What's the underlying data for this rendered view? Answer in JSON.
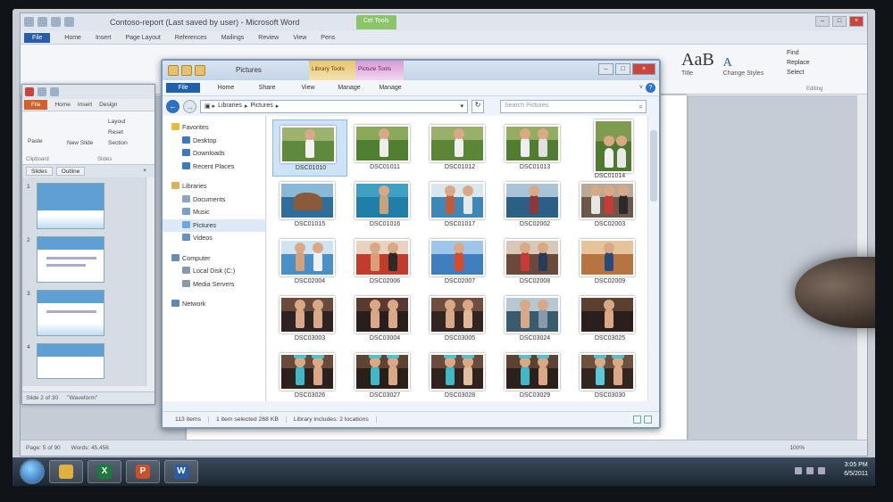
{
  "word": {
    "title": "Contoso-report (Last saved by user) - Microsoft Word",
    "context_tab": "Cel Tools",
    "tabs": [
      "File",
      "Home",
      "Insert",
      "Page Layout",
      "References",
      "Mailings",
      "Review",
      "View",
      "Pens"
    ],
    "style_sample": "AaB",
    "style_labels": [
      "Title",
      "Change Styles"
    ],
    "editing": [
      "Find",
      "Replace",
      "Select"
    ],
    "editing_group": "Editing",
    "status": {
      "page": "Page: 5 of 90",
      "words": "Words: 45,456",
      "zoom": "100%"
    }
  },
  "ppt": {
    "tabs": [
      "File",
      "Home",
      "Insert",
      "Design"
    ],
    "ribbon": {
      "paste": "Paste",
      "new_slide": "New Slide",
      "layout": "Layout",
      "reset": "Reset",
      "section": "Section",
      "clipboard": "Clipboard",
      "slides": "Slides"
    },
    "pane_tabs": [
      "Slides",
      "Outline"
    ],
    "slide_numbers": [
      "1",
      "2",
      "3",
      "4"
    ],
    "status": {
      "slide": "Slide 2 of 30",
      "theme": "\"Waveform\""
    }
  },
  "explorer": {
    "title": "Pictures",
    "context_tabs": [
      "Library Tools",
      "Picture Tools"
    ],
    "ribbon_tabs": [
      "File",
      "Home",
      "Share",
      "View",
      "Manage",
      "Manage"
    ],
    "breadcrumb": [
      "Libraries",
      "Pictures"
    ],
    "search_placeholder": "Search Pictures",
    "nav": [
      {
        "label": "Favorites",
        "top": true,
        "color": "#e8b93a"
      },
      {
        "label": "Desktop",
        "color": "#3c78c4"
      },
      {
        "label": "Downloads",
        "color": "#3c78c4"
      },
      {
        "label": "Recent Places",
        "color": "#3c78c4"
      },
      {
        "gap": true
      },
      {
        "label": "Libraries",
        "top": true,
        "color": "#d9b25a"
      },
      {
        "label": "Documents",
        "color": "#8ea6c2"
      },
      {
        "label": "Music",
        "color": "#7a9fd1"
      },
      {
        "label": "Pictures",
        "color": "#6fa7d8",
        "selected": true
      },
      {
        "label": "Videos",
        "color": "#6c8fbf"
      },
      {
        "gap": true
      },
      {
        "label": "Computer",
        "top": true,
        "color": "#6b8bb3"
      },
      {
        "label": "Local Disk (C:)",
        "color": "#8a99aa"
      },
      {
        "label": "Media Servers",
        "color": "#8a99aa"
      },
      {
        "gap": true
      },
      {
        "label": "Network",
        "top": true,
        "color": "#5f88b8"
      }
    ],
    "files": [
      {
        "name": "DSC01010",
        "bg": "#5f8a3c",
        "sky": "#9cb36d",
        "figs": [
          "#f2f2f2"
        ],
        "selected": true
      },
      {
        "name": "DSC01011",
        "bg": "#4f7f2f",
        "sky": "#8aa95a",
        "figs": [
          "#ececec"
        ]
      },
      {
        "name": "DSC01012",
        "bg": "#5a8635",
        "sky": "#98b06a",
        "figs": [
          "#f0f0f0"
        ]
      },
      {
        "name": "DSC01013",
        "bg": "#527d31",
        "sky": "#94ad63",
        "figs": [
          "#eeeeee",
          "#e0e0e0"
        ]
      },
      {
        "name": "DSC01014",
        "bg": "#4d7a2e",
        "sky": "#7d9c50",
        "figs": [
          "#f2f2f2",
          "#e8e8e8"
        ],
        "tall": true
      },
      {
        "name": "DSC01015",
        "bg": "#2f6d9a",
        "sky": "#8ab8d8",
        "rock": "#8a5a3a"
      },
      {
        "name": "DSC01016",
        "bg": "#1f7fa8",
        "sky": "#3fa0c4",
        "figs": [
          "#c9a27a"
        ]
      },
      {
        "name": "DSC01017",
        "bg": "#3d88b8",
        "sky": "#d9e6ee",
        "figs": [
          "#c45a3c",
          "#e8e8e8"
        ]
      },
      {
        "name": "DSC02002",
        "bg": "#2c5f85",
        "sky": "#a9c4d8",
        "figs": [
          "#8a3a3a"
        ]
      },
      {
        "name": "DSC02003",
        "bg": "#6c5848",
        "sky": "#b8a898",
        "figs": [
          "#e6e6e6",
          "#c83a3a",
          "#2a2a2a"
        ]
      },
      {
        "name": "DSC02004",
        "bg": "#4a90c8",
        "sky": "#cfe3f2",
        "figs": [
          "#d8a07a",
          "#f0f0f0"
        ]
      },
      {
        "name": "DSC02006",
        "bg": "#c43b2b",
        "sky": "#e8d2c2",
        "figs": [
          "#d8a07a",
          "#2a2a2a"
        ]
      },
      {
        "name": "DSC02007",
        "bg": "#3f7fc0",
        "sky": "#9ec6ea",
        "figs": [
          "#d84a2a"
        ]
      },
      {
        "name": "DSC02008",
        "bg": "#6a4a3a",
        "sky": "#d8c8b8",
        "figs": [
          "#c83a3a",
          "#2a3a5a"
        ]
      },
      {
        "name": "DSC02009",
        "bg": "#b87440",
        "sky": "#e6c49a",
        "figs": [
          "#2a4a7a"
        ]
      },
      {
        "name": "DSC03003",
        "bg": "#2e2320",
        "sky": "#6a4a3a",
        "figs": [
          "#d8a888",
          "#d8a888"
        ]
      },
      {
        "name": "DSC03004",
        "bg": "#2a1e1c",
        "sky": "#5a3a30",
        "figs": [
          "#d8a888",
          "#d8a888"
        ]
      },
      {
        "name": "DSC03005",
        "bg": "#332622",
        "sky": "#6e4e40",
        "figs": [
          "#d8a888",
          "#e0b898"
        ]
      },
      {
        "name": "DSC03024",
        "bg": "#3a5a6e",
        "sky": "#b8c8d2",
        "figs": [
          "#d8a888",
          "#8a9aaa"
        ]
      },
      {
        "name": "DSC03025",
        "bg": "#2a1f1b",
        "sky": "#5a4030",
        "figs": [
          "#d8a888"
        ]
      },
      {
        "name": "DSC03026",
        "bg": "#2c211d",
        "sky": "#6a4a3a",
        "figs": [
          "#3fb8c8",
          "#d8a888"
        ],
        "hats": true
      },
      {
        "name": "DSC03027",
        "bg": "#2a1e1a",
        "sky": "#5e4232",
        "figs": [
          "#3fb8c8",
          "#d8a888"
        ],
        "hats": true
      },
      {
        "name": "DSC03028",
        "bg": "#30231e",
        "sky": "#6a4c3c",
        "figs": [
          "#3fb8c8",
          "#e0c0a0"
        ],
        "hats": true
      },
      {
        "name": "DSC03029",
        "bg": "#2b201c",
        "sky": "#5c4232",
        "figs": [
          "#3fb8c8",
          "#d8a888"
        ],
        "hats": true
      },
      {
        "name": "DSC03030",
        "bg": "#332620",
        "sky": "#6e5040",
        "figs": [
          "#5ac8d8",
          "#d8a888"
        ],
        "hats": true
      }
    ],
    "status": {
      "count": "113 items",
      "selected": "1 item selected  268 KB",
      "library": "Library includes:  2 locations"
    }
  },
  "taskbar": {
    "apps": [
      {
        "name": "explorer",
        "color": "#e0b040",
        "glyph": ""
      },
      {
        "name": "excel",
        "color": "#1e7a3c",
        "glyph": "X"
      },
      {
        "name": "powerpoint",
        "color": "#c8502a",
        "glyph": "P"
      },
      {
        "name": "word",
        "color": "#2a5ca8",
        "glyph": "W"
      }
    ],
    "time": "3:05 PM",
    "date": "6/5/2011"
  }
}
